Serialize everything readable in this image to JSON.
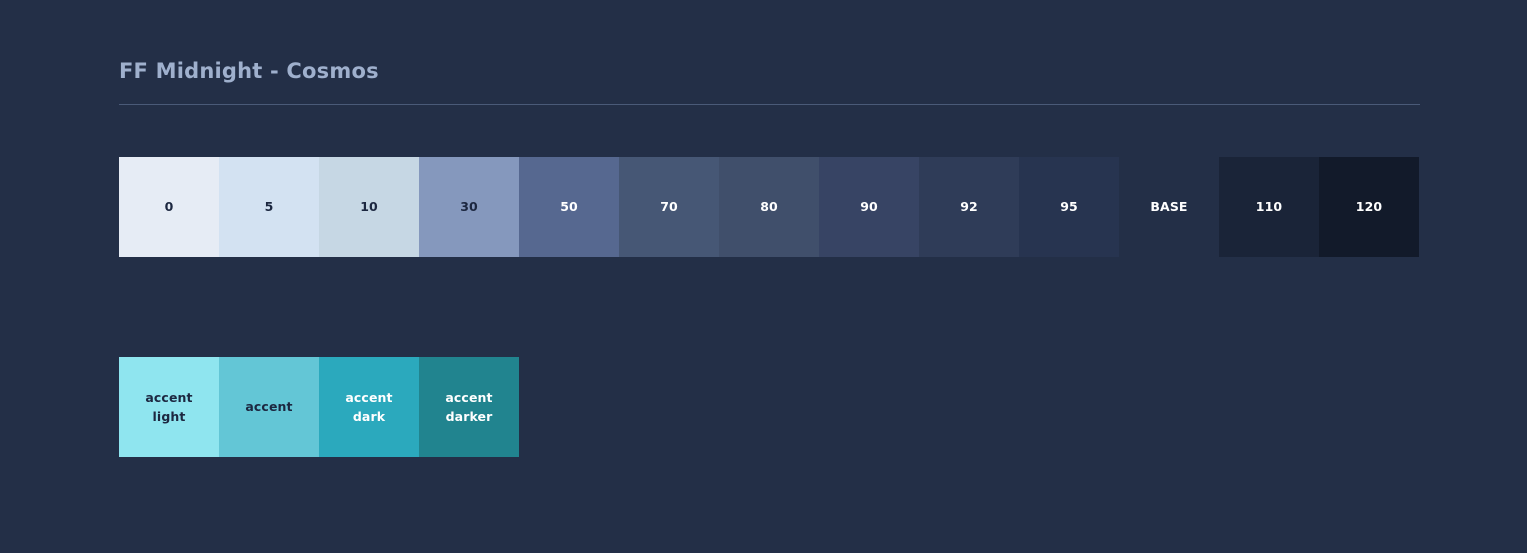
{
  "page": {
    "background_color": "#232f47",
    "title": "FF Midnight - Cosmos"
  },
  "neutral_ramp": {
    "name": "cosmos-neutral-ramp",
    "swatches": [
      {
        "label": "0",
        "color": "#e6ecf5",
        "text_color": "#1c2740"
      },
      {
        "label": "5",
        "color": "#d3e2f2",
        "text_color": "#1c2740"
      },
      {
        "label": "10",
        "color": "#c6d7e4",
        "text_color": "#1c2740"
      },
      {
        "label": "30",
        "color": "#8598bd",
        "text_color": "#1c2740"
      },
      {
        "label": "50",
        "color": "#566890",
        "text_color": "#ffffff"
      },
      {
        "label": "70",
        "color": "#465775",
        "text_color": "#ffffff"
      },
      {
        "label": "80",
        "color": "#404f6b",
        "text_color": "#ffffff"
      },
      {
        "label": "90",
        "color": "#374464",
        "text_color": "#ffffff"
      },
      {
        "label": "92",
        "color": "#2f3c58",
        "text_color": "#ffffff"
      },
      {
        "label": "95",
        "color": "#273450",
        "text_color": "#ffffff"
      },
      {
        "label": "BASE",
        "color": "#232f47",
        "text_color": "#ffffff"
      },
      {
        "label": "110",
        "color": "#1a2438",
        "text_color": "#ffffff"
      },
      {
        "label": "120",
        "color": "#121a2a",
        "text_color": "#ffffff"
      }
    ]
  },
  "accent_ramp": {
    "name": "cosmos-accent-ramp",
    "swatches": [
      {
        "label": "accent\nlight",
        "color": "#8fe5ef",
        "text_color": "#1c2740"
      },
      {
        "label": "accent",
        "color": "#63c6d6",
        "text_color": "#1c2740"
      },
      {
        "label": "accent\ndark",
        "color": "#2ba9bd",
        "text_color": "#ffffff"
      },
      {
        "label": "accent\ndarker",
        "color": "#21848f",
        "text_color": "#ffffff"
      }
    ]
  }
}
